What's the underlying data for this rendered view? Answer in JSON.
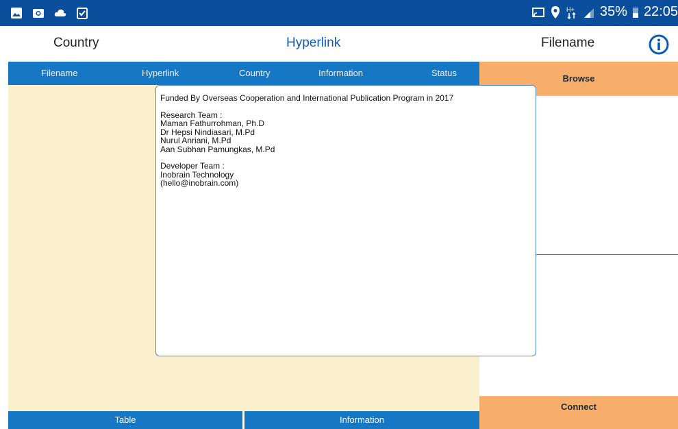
{
  "status_bar": {
    "left_icons": [
      "gallery-icon",
      "camera-icon",
      "cloud-icon",
      "clipboard-check-icon"
    ],
    "right_icons": [
      "cast-icon",
      "location-pin-icon",
      "network-hplus-icon",
      "signal-icon"
    ],
    "battery": "35%",
    "time": "22:05"
  },
  "header": {
    "country": "Country",
    "hyperlink": "Hyperlink",
    "filename": "Filename",
    "info_icon": "info-icon"
  },
  "tabs": [
    "Filename",
    "Hyperlink",
    "Country",
    "Information",
    "Status"
  ],
  "right_panel": {
    "browse_label": "Browse",
    "connect_label": "Connect"
  },
  "bottom_bar": {
    "table_label": "Table",
    "information_label": "Information"
  },
  "dialog": {
    "funding": "Funded By Overseas Cooperation and International Publication Program in 2017",
    "research_heading": "Research Team :",
    "research_members": [
      "Maman Fathurrohman, Ph.D",
      "Dr Hepsi Nindiasari, M.Pd",
      "Nurul Anriani, M.Pd",
      "Aan Subhan Pamungkas, M.Pd"
    ],
    "developer_heading": "Developer Team :",
    "developer_name": "Inobrain Technology",
    "developer_email": "(hello@inobrain.com)"
  },
  "colors": {
    "status_bar": "#0b4f9c",
    "tab_bar": "#1677c4",
    "panel_bg": "#fbf0cd",
    "action_button": "#f6ae6a",
    "hyperlink_text": "#0d5bb5"
  }
}
